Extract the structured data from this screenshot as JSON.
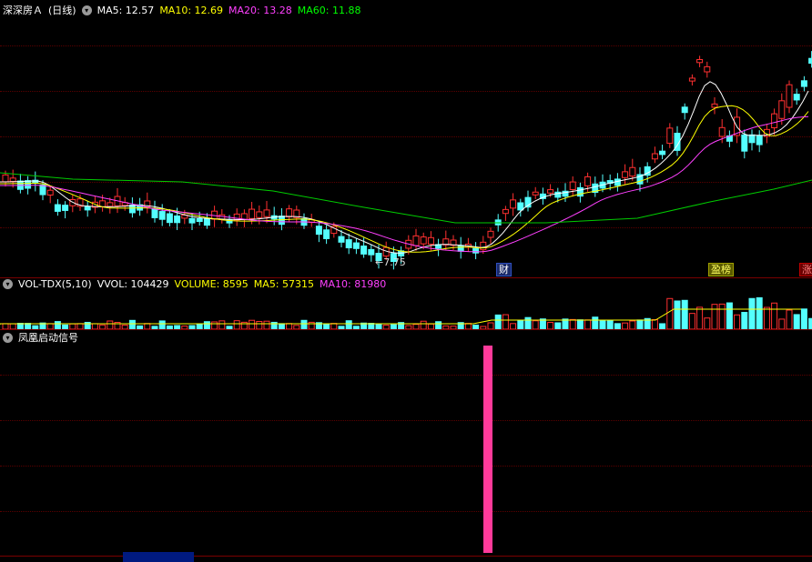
{
  "header": {
    "stock": "深深房Ａ",
    "period": "(日线)",
    "ma": [
      {
        "label": "MA5: 12.57",
        "color": "#ffffff"
      },
      {
        "label": "MA10: 12.69",
        "color": "#ffff00"
      },
      {
        "label": "MA20: 13.28",
        "color": "#ff40ff"
      },
      {
        "label": "MA60: 11.88",
        "color": "#00ff00"
      }
    ]
  },
  "volume": {
    "title": "VOL-TDX(5,10)",
    "vvol": "VVOL: 104429",
    "volume": "VOLUME: 8595",
    "ma5": "MA5: 57315",
    "ma10": "MA10: 81980"
  },
  "signal": {
    "title": "凤凰启动信号"
  },
  "chart": {
    "low_label": "←7.75",
    "tags": {
      "cai": "财",
      "ying": "盈榜",
      "zhang": "涨"
    }
  },
  "colors": {
    "up": "#ff3030",
    "down": "#54ffff",
    "signal": "#ff3a9a",
    "grid": "#7a0000"
  },
  "icons": [
    "panel-toggle-icon"
  ]
}
